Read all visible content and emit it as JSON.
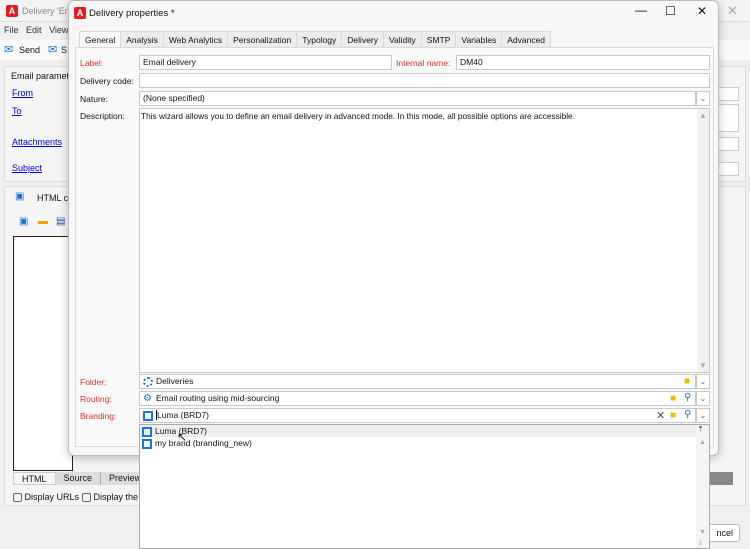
{
  "background_window": {
    "title": "Delivery 'Em",
    "menu": [
      "File",
      "Edit",
      "View"
    ],
    "toolbar": {
      "send": "Send",
      "second": "S"
    },
    "email_params_title": "Email paramet",
    "links": [
      "From",
      "To",
      "Attachments",
      "Subject"
    ],
    "html_content_label": "HTML c",
    "bottom_tabs": [
      "HTML",
      "Source",
      "Preview"
    ],
    "checkboxes": [
      "Display URLs",
      "Display the H"
    ],
    "cancel_label": "ncel"
  },
  "dialog": {
    "title": "Delivery properties *",
    "tabs": [
      "General",
      "Analysis",
      "Web Analytics",
      "Personalization",
      "Typology",
      "Delivery",
      "Validity",
      "SMTP",
      "Variables",
      "Advanced"
    ],
    "active_tab": "General",
    "form": {
      "label_label": "Label:",
      "label_value": "Email delivery",
      "internal_name_label": "Internal name:",
      "internal_name_value": "DM40",
      "delivery_code_label": "Delivery code:",
      "delivery_code_value": "",
      "nature_label": "Nature:",
      "nature_value": "(None specified)",
      "description_label": "Description:",
      "description_value": "This wizard allows you to define an email delivery in advanced mode. In this mode, all possible options are accessible.",
      "folder_label": "Folder:",
      "folder_value": "Deliveries",
      "routing_label": "Routing:",
      "routing_value": "Email routing using mid-sourcing",
      "branding_label": "Branding:",
      "branding_value": "Luma (BRD7)"
    },
    "branding_dropdown": [
      {
        "label": "Luma (BRD7)",
        "highlighted": true
      },
      {
        "label": "my brand (branding_new)",
        "highlighted": false
      }
    ]
  },
  "colors": {
    "required_label": "#e0312c",
    "link": "#0000ee",
    "folder": "#f5b800",
    "search": "#1a73e8"
  }
}
